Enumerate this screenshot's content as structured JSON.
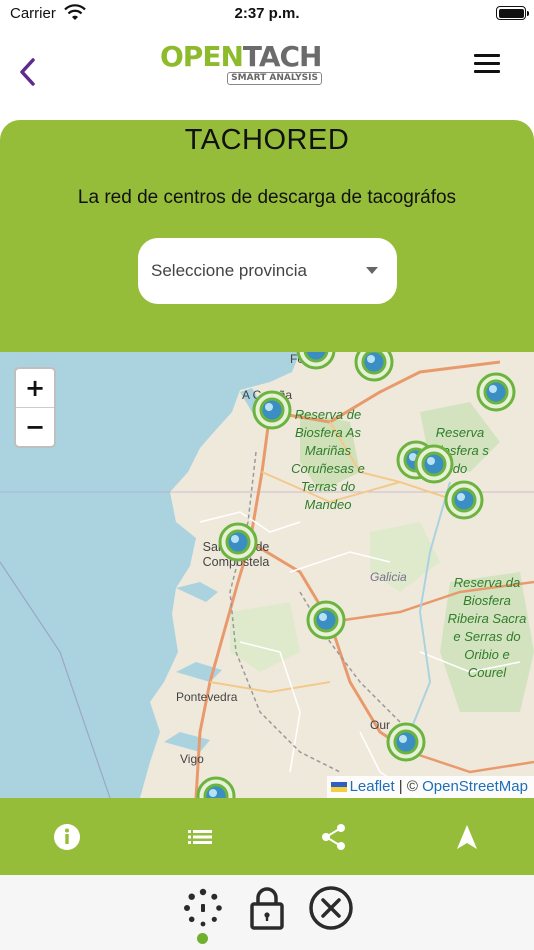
{
  "status_bar": {
    "carrier": "Carrier",
    "time": "2:37 p.m."
  },
  "header": {
    "logo_primary": "OPEN",
    "logo_secondary": "TACH",
    "logo_tagline": "SMART ANALYSIS",
    "back_icon": "chevron-left-icon",
    "menu_icon": "hamburger-menu-icon"
  },
  "panel": {
    "title": "TACHORED",
    "subtitle": "La red de centros de descarga de tacográfos",
    "province_select": {
      "placeholder": "Seleccione provincia"
    }
  },
  "map": {
    "zoom_in_label": "+",
    "zoom_out_label": "−",
    "place_labels": [
      "Fe",
      "A Coruña",
      "Santiago de Compostela",
      "Pontevedra",
      "Vigo",
      "Our",
      "Galicia"
    ],
    "reserve_labels": [
      "Reserva de Biosfera As Mariñas Coruñesas e Terras do Mandeo",
      "Reserva Biosfera s do",
      "Reserva da Biosfera Ribeira Sacra e Serras do Oribio e Courel"
    ],
    "marker_count": 12,
    "attribution": {
      "leaflet": "Leaflet",
      "separator": "| ©",
      "osm": "OpenStreetMap"
    }
  },
  "toolbar": {
    "items": [
      "info-icon",
      "list-icon",
      "share-icon",
      "navigation-arrow-icon"
    ]
  },
  "bottom_nav": {
    "items": [
      "loading-spinner-icon",
      "lock-icon",
      "close-circle-icon"
    ],
    "active_index": 0
  },
  "colors": {
    "brand_green": "#95bd3a",
    "logo_green": "#8dbb2c",
    "accent_purple": "#5e2a8c",
    "sea": "#aad3df",
    "marker_green": "#6db33f"
  }
}
